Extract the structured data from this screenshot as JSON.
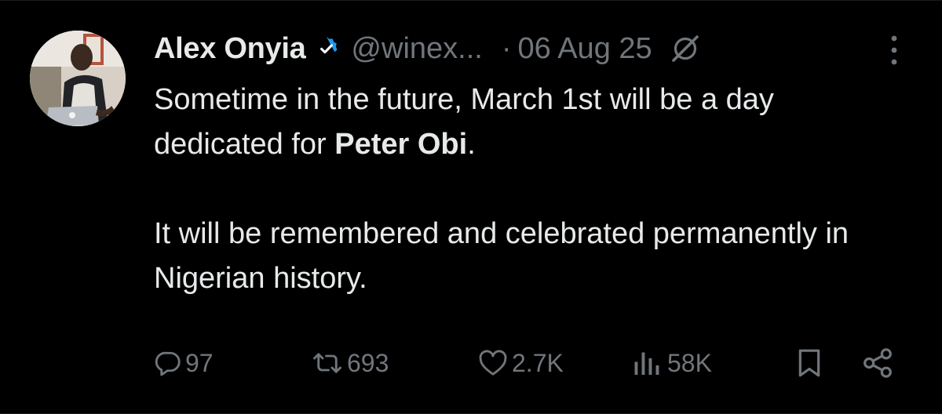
{
  "tweet": {
    "author_name": "Alex Onyia",
    "handle": "@winex...",
    "separator": "·",
    "date": "06 Aug 25",
    "text_line1_before": "Sometime in the future, March 1st will be a day dedicated for ",
    "text_line1_bold": "Peter Obi",
    "text_line1_after": ".",
    "text_paragraph2": "It will be remembered and celebrated permanently in Nigerian history."
  },
  "icons": {
    "verified": "verified-badge-icon",
    "grok": "grok-icon",
    "more": "more-options-icon",
    "reply": "reply-icon",
    "repost": "repost-icon",
    "like": "like-icon",
    "views": "views-icon",
    "bookmark": "bookmark-icon",
    "share": "share-icon"
  },
  "actions": {
    "replies": "97",
    "reposts": "693",
    "likes": "2.7K",
    "views": "58K"
  },
  "colors": {
    "background": "#000000",
    "text_primary": "#e7e9ea",
    "text_secondary": "#71767b",
    "verified_blue": "#1d9bf0"
  }
}
